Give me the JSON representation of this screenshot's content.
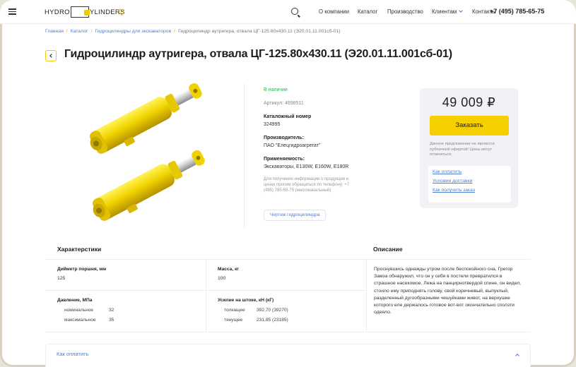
{
  "header": {
    "logo_left": "HYDRO",
    "logo_right": "YLINDERS",
    "nav": [
      "О компании",
      "Каталог",
      "Производство",
      "Клиентам",
      "Контакты"
    ],
    "phone": "+7 (495) 785-65-75"
  },
  "breadcrumbs": [
    "Главная",
    "Каталог",
    "Гидроцилиндры для экскаваторов",
    "Гидроцилиндр аутригера, отвала ЦГ-125.80х430.11 (Э20.01.11.001сб-01)"
  ],
  "title": "Гидроцилиндр аутригера, отвала ЦГ-125.80х430.11 (Э20.01.11.001сб-01)",
  "info": {
    "stock": "В наличии",
    "sku": "Артикул: 4698511",
    "catalog_label": "Каталожный номер",
    "catalog_value": "324995",
    "maker_label": "Производитель:",
    "maker_value": "ПАО \"Елецгидроагрегат\"",
    "applicability_label": "Применяемость:",
    "applicability_value": "Экскаваторы, Е130W, Е160W, Е180R",
    "note": "Для получения информации о продукции и ценах просим обращаться по телефону: +7 (495) 785-65-75 (многоканальный)",
    "drawing_button": "Чертеж гидроцилиндра"
  },
  "price_box": {
    "price": "49 009 ₽",
    "order_button": "Заказать",
    "disclaimer": "Данное предложение не является публичной офертой! Цены могут отличаться.",
    "links": [
      "Как оплатить",
      "Условия доставки",
      "Как получить заказ"
    ]
  },
  "specs": {
    "heading": "Характерстики",
    "piston_label": "Дийметр поршня, мм",
    "piston_value": "125",
    "mass_label": "Масса, кг",
    "mass_value": "100",
    "pressure_label": "Давление, МПа",
    "pressure_rows": [
      {
        "name": "номинальное",
        "value": "32"
      },
      {
        "name": "максимальное",
        "value": "35"
      }
    ],
    "force_label": "Усилие на штоке, кН (кГ)",
    "force_rows": [
      {
        "name": "толкащее",
        "value": "392,70 (39270)"
      },
      {
        "name": "тянущее",
        "value": "231,85 (23185)"
      }
    ]
  },
  "description": {
    "heading": "Описание",
    "text": "Проснувшись однажды утром после беспокойного сна, Грегор Замза обнаружил, что он у себя в постели превратился в страшное насекомое. Лежа на панцирнотвердой спине, он видел, стоило ему приподнять голову, свой коричневый, выпуклый, разделенный дугообразными чешуйками живот, на верхушке которого еле держалось готовое вот-вот окончательно сползти одеяло."
  },
  "accordion": {
    "title": "Как оплатить"
  },
  "colors": {
    "accent": "#f6cf00",
    "link": "#4a7fd3",
    "stock": "#2fb44b"
  }
}
